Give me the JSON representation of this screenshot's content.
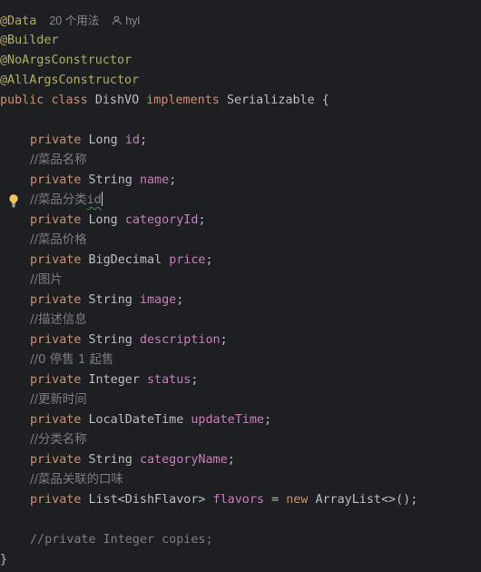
{
  "code_hints": {
    "usages": "20 个用法",
    "author": "hyl"
  },
  "lines": {
    "l1_anno": "@Data",
    "l2_anno": "@Builder",
    "l3_anno": "@NoArgsConstructor",
    "l4_anno": "@AllArgsConstructor",
    "l5_public": "public",
    "l5_class": "class",
    "l5_name": "DishVO",
    "l5_implements": "implements",
    "l5_iface": "Serializable",
    "l5_brace": "{",
    "f_id_mod": "private",
    "f_id_type": "Long",
    "f_id_name": "id",
    "c_name": "//菜品名称",
    "f_name_mod": "private",
    "f_name_type": "String",
    "f_name_name": "name",
    "c_category_prefix": "//菜品分类",
    "c_category_suffix": "id",
    "f_catid_mod": "private",
    "f_catid_type": "Long",
    "f_catid_name": "categoryId",
    "c_price": "//菜品价格",
    "f_price_mod": "private",
    "f_price_type": "BigDecimal",
    "f_price_name": "price",
    "c_image": "//图片",
    "f_image_mod": "private",
    "f_image_type": "String",
    "f_image_name": "image",
    "c_desc": "//描述信息",
    "f_desc_mod": "private",
    "f_desc_type": "String",
    "f_desc_name": "description",
    "c_status": "//0 停售 1 起售",
    "f_status_mod": "private",
    "f_status_type": "Integer",
    "f_status_name": "status",
    "c_update": "//更新时间",
    "f_update_mod": "private",
    "f_update_type": "LocalDateTime",
    "f_update_name": "updateTime",
    "c_catname": "//分类名称",
    "f_catname_mod": "private",
    "f_catname_type": "String",
    "f_catname_name": "categoryName",
    "c_flavors": "//菜品关联的口味",
    "f_flavors_mod": "private",
    "f_flavors_type": "List<DishFlavor>",
    "f_flavors_name": "flavors",
    "f_flavors_eq": "=",
    "f_flavors_new": "new",
    "f_flavors_init": "ArrayList<>();",
    "c_copies": "//private Integer copies;",
    "closing_brace": "}"
  },
  "colors": {
    "background": "#1e1f22",
    "keyword": "#cf8e6d",
    "annotation": "#b3ae60",
    "field": "#c77dbb",
    "comment": "#7a7e85",
    "text": "#bcbec4"
  },
  "icons": [
    "user-icon",
    "lightbulb-icon"
  ]
}
